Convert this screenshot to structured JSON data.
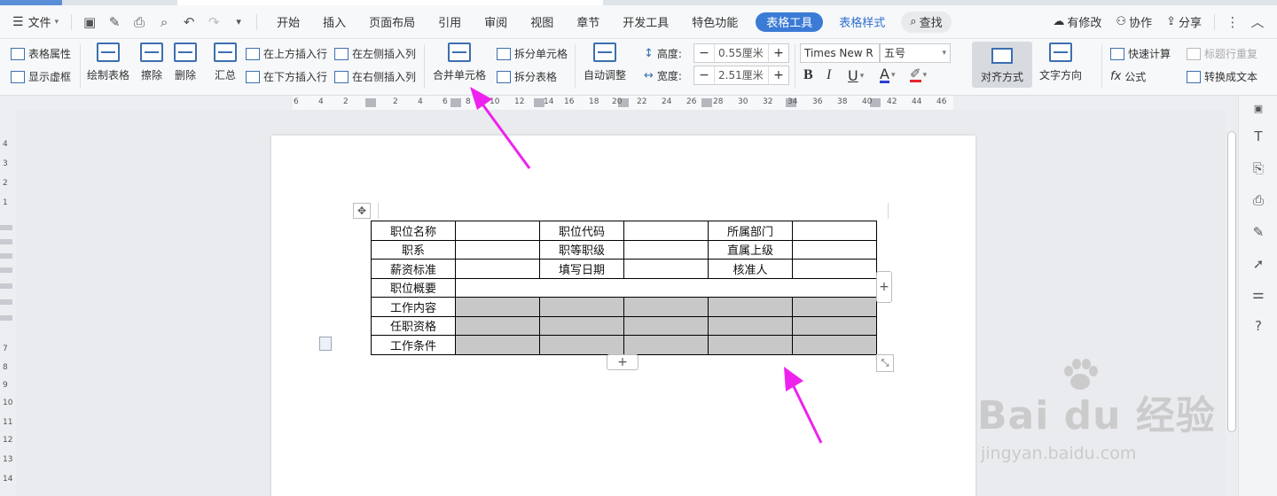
{
  "menubar": {
    "file_label": "文件",
    "tabs": [
      "开始",
      "插入",
      "页面布局",
      "引用",
      "审阅",
      "视图",
      "章节",
      "开发工具",
      "特色功能"
    ],
    "active_tab": "表格工具",
    "extra_tab": "表格样式",
    "search_label": "查找",
    "modified_label": "有修改",
    "collab_label": "协作",
    "share_label": "分享"
  },
  "ribbon": {
    "table_props": "表格属性",
    "show_grid": "显示虚框",
    "draw_table": "绘制表格",
    "erase": "擦除",
    "delete": "删除",
    "summary": "汇总",
    "insert_above": "在上方插入行",
    "insert_below": "在下方插入行",
    "insert_left": "在左侧插入列",
    "insert_right": "在右侧插入列",
    "merge_cells": "合并单元格",
    "split_cells": "拆分单元格",
    "split_table": "拆分表格",
    "auto_adjust": "自动调整",
    "height_label": "高度:",
    "height_value": "0.55厘米",
    "width_label": "宽度:",
    "width_value": "2.51厘米",
    "font_name": "Times New R",
    "font_size": "五号",
    "bold": "B",
    "italic": "I",
    "underline": "U",
    "font_color_glyph": "A",
    "align_mode": "对齐方式",
    "text_direction": "文字方向",
    "quick_calc": "快速计算",
    "repeat_header": "标题行重复",
    "formula": "公式",
    "to_text": "转换成文本"
  },
  "ruler": {
    "ticks": [
      "6",
      "4",
      "2",
      "2",
      "4",
      "6",
      "8",
      "10",
      "12",
      "14",
      "16",
      "18",
      "20",
      "22",
      "24",
      "26",
      "28",
      "30",
      "32",
      "34",
      "36",
      "38",
      "40",
      "42",
      "44",
      "46"
    ]
  },
  "vruler": {
    "ticks": [
      "4",
      "3",
      "2",
      "1",
      "7",
      "8",
      "9",
      "10",
      "11",
      "12",
      "13",
      "14"
    ]
  },
  "table": {
    "rows": [
      [
        "职位名称",
        "",
        "职位代码",
        "",
        "所属部门",
        ""
      ],
      [
        "职系",
        "",
        "职等职级",
        "",
        "直属上级",
        ""
      ],
      [
        "薪资标准",
        "",
        "填写日期",
        "",
        "核准人",
        ""
      ],
      [
        "职位概要"
      ],
      [
        "工作内容",
        "",
        "",
        "",
        "",
        ""
      ],
      [
        "任职资格",
        "",
        "",
        "",
        "",
        ""
      ],
      [
        "工作条件",
        "",
        "",
        "",
        "",
        ""
      ]
    ],
    "selected_rows": [
      4,
      5,
      6
    ]
  },
  "watermark": {
    "brand": "Bai du 经验",
    "url": "jingyan.baidu.com"
  },
  "colors": {
    "accent": "#3a7bd5",
    "arrow": "#ee22ee",
    "selection": "#c8c8c8"
  }
}
